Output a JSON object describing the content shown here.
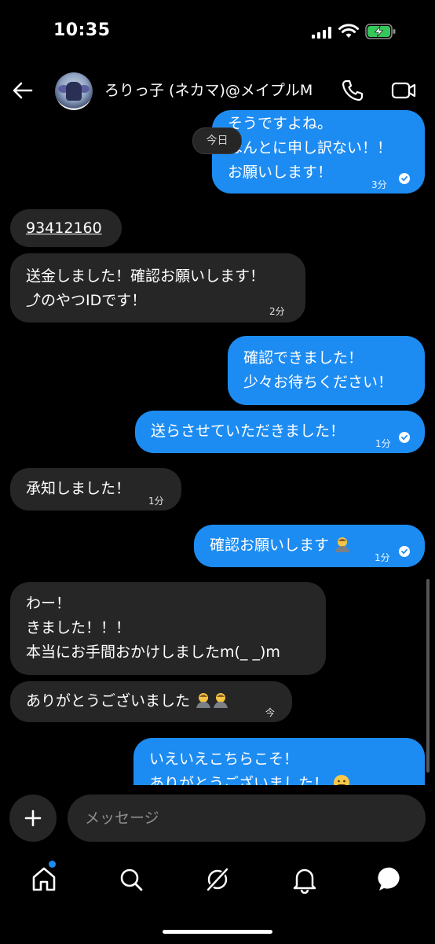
{
  "status_bar": {
    "time": "10:35"
  },
  "header": {
    "contact_name": "ろりっ子 (ネカマ)@メイプルM"
  },
  "date_pill": "今日",
  "messages": [
    {
      "dir": "out",
      "lines": [
        "そうですよね。",
        "ほんとに申し訳ない！！",
        "お願いします！"
      ],
      "time": "3分",
      "read": true
    },
    {
      "dir": "in",
      "text": "93412160",
      "underline": true
    },
    {
      "dir": "in",
      "lines": [
        "送金しました！確認お願いします！",
        "⤴のやつIDです！"
      ],
      "time": "2分"
    },
    {
      "dir": "out",
      "lines": [
        "確認できました！",
        "少々お待ちください！"
      ]
    },
    {
      "dir": "out",
      "text": "送らさせていただきました！",
      "time": "1分",
      "read": true
    },
    {
      "dir": "in",
      "text": "承知しました！",
      "time": "1分"
    },
    {
      "dir": "out",
      "text": "確認お願いします",
      "emoji": "bowing-person",
      "time": "1分",
      "read": true
    },
    {
      "dir": "in",
      "lines": [
        "わー！",
        "きました！！！",
        "本当にお手間おかけしましたm(_ _)m"
      ]
    },
    {
      "dir": "in",
      "text": "ありがとうございました",
      "emoji": "bowing-person x2",
      "time": "今"
    },
    {
      "dir": "out",
      "lines": [
        "いえいえこちらこそ！",
        "ありがとうございました！"
      ],
      "emoji": "grinning-face"
    }
  ],
  "composer": {
    "placeholder": "メッセージ"
  },
  "tab_bar": [
    "home-icon",
    "search-icon",
    "grok-icon",
    "notifications-icon",
    "messages-icon"
  ],
  "colors": {
    "outgoing_bubble": "#1d8cf2",
    "incoming_bubble": "#262626",
    "background": "#000000"
  }
}
